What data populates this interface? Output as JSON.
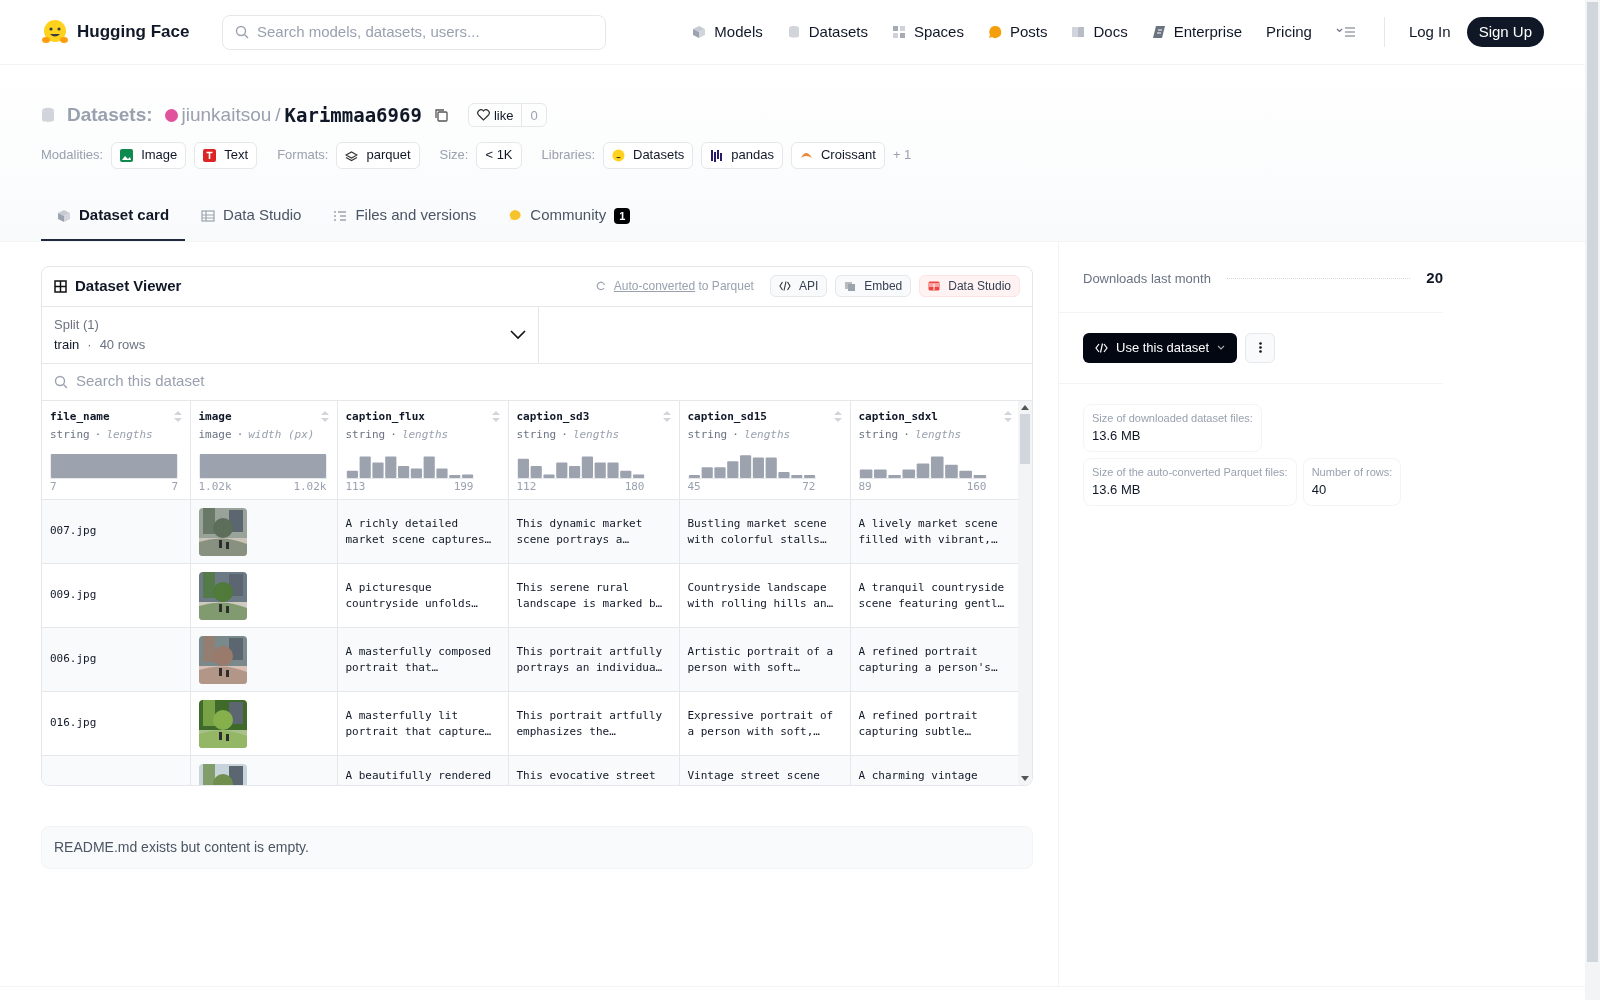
{
  "header": {
    "logo": "Hugging Face",
    "search_placeholder": "Search models, datasets, users...",
    "nav": [
      "Models",
      "Datasets",
      "Spaces",
      "Posts",
      "Docs",
      "Enterprise",
      "Pricing"
    ],
    "login": "Log In",
    "signup": "Sign Up"
  },
  "repo": {
    "type_label": "Datasets:",
    "owner": "jiunkaitsou",
    "separator": "/",
    "name": "Karimmaa6969",
    "like_label": "like",
    "like_count": "0"
  },
  "tag_groups": [
    {
      "label": "Modalities:",
      "tags": [
        "Image",
        "Text"
      ]
    },
    {
      "label": "Formats:",
      "tags": [
        "parquet"
      ]
    },
    {
      "label": "Size:",
      "tags": [
        "< 1K"
      ]
    },
    {
      "label": "Libraries:",
      "tags": [
        "Datasets",
        "pandas",
        "Croissant"
      ],
      "more": "+ 1"
    }
  ],
  "tabs": [
    {
      "label": "Dataset card",
      "selected": true
    },
    {
      "label": "Data Studio",
      "selected": false
    },
    {
      "label": "Files and versions",
      "selected": false
    },
    {
      "label": "Community",
      "selected": false,
      "badge": "1"
    }
  ],
  "viewer": {
    "title": "Dataset Viewer",
    "converted_link": "Auto-converted",
    "converted_text": "to Parquet",
    "buttons": [
      {
        "label": "API",
        "kind": "plain"
      },
      {
        "label": "Embed",
        "kind": "plain"
      },
      {
        "label": "Data Studio",
        "kind": "accent"
      }
    ],
    "split_label": "Split (1)",
    "split_value": "train",
    "split_sep": "·",
    "split_rows": "40 rows",
    "search_placeholder": "Search this dataset",
    "columns": [
      {
        "name": "file_name",
        "dtype": "string",
        "sep": "·",
        "stat": "lengths",
        "min": "7",
        "max": "7"
      },
      {
        "name": "image",
        "dtype": "image",
        "sep": "·",
        "stat": "width (px)",
        "min": "1.02k",
        "max": "1.02k"
      },
      {
        "name": "caption_flux",
        "dtype": "string",
        "sep": "·",
        "stat": "lengths",
        "min": "113",
        "max": "199"
      },
      {
        "name": "caption_sd3",
        "dtype": "string",
        "sep": "·",
        "stat": "lengths",
        "min": "112",
        "max": "180"
      },
      {
        "name": "caption_sd15",
        "dtype": "string",
        "sep": "·",
        "stat": "lengths",
        "min": "45",
        "max": "72"
      },
      {
        "name": "caption_sdxl",
        "dtype": "string",
        "sep": "·",
        "stat": "lengths",
        "min": "89",
        "max": "160"
      }
    ],
    "rows": [
      {
        "file_name": "007.jpg",
        "image": {
          "kind": "picture"
        },
        "captions": [
          "A richly detailed market scene captures…",
          "This dynamic market scene portrays a…",
          "Bustling market scene with colorful stalls…",
          "A lively market scene filled with vibrant,…"
        ]
      },
      {
        "file_name": "009.jpg",
        "image": {
          "kind": "picture"
        },
        "captions": [
          "A picturesque countryside unfolds…",
          "This serene rural landscape is marked b…",
          "Countryside landscape with rolling hills an…",
          "A tranquil countryside scene featuring gentl…"
        ]
      },
      {
        "file_name": "006.jpg",
        "image": {
          "kind": "picture"
        },
        "captions": [
          "A masterfully composed portrait that…",
          "This portrait artfully portrays an individua…",
          "Artistic portrait of a person with soft…",
          "A refined portrait capturing a person's…"
        ]
      },
      {
        "file_name": "016.jpg",
        "image": {
          "kind": "picture"
        },
        "captions": [
          "A masterfully lit portrait that capture…",
          "This portrait artfully emphasizes the…",
          "Expressive portrait of a person with soft,…",
          "A refined portrait capturing subtle…"
        ]
      },
      {
        "image": {
          "kind": "picture"
        },
        "captions": [
          "A beautifully rendered",
          "This evocative street",
          "Vintage street scene",
          "A charming vintage"
        ]
      }
    ]
  },
  "readme": "README.md exists but content is empty.",
  "sidebar": {
    "downloads_label": "Downloads last month",
    "downloads_value": "20",
    "use_button": "Use this dataset",
    "stats": [
      {
        "label": "Size of downloaded dataset files:",
        "value": "13.6 MB"
      },
      {
        "label": "Size of the auto-converted Parquet files:",
        "value": "13.6 MB"
      },
      {
        "label": "Number of rows:",
        "value": "40"
      }
    ]
  }
}
